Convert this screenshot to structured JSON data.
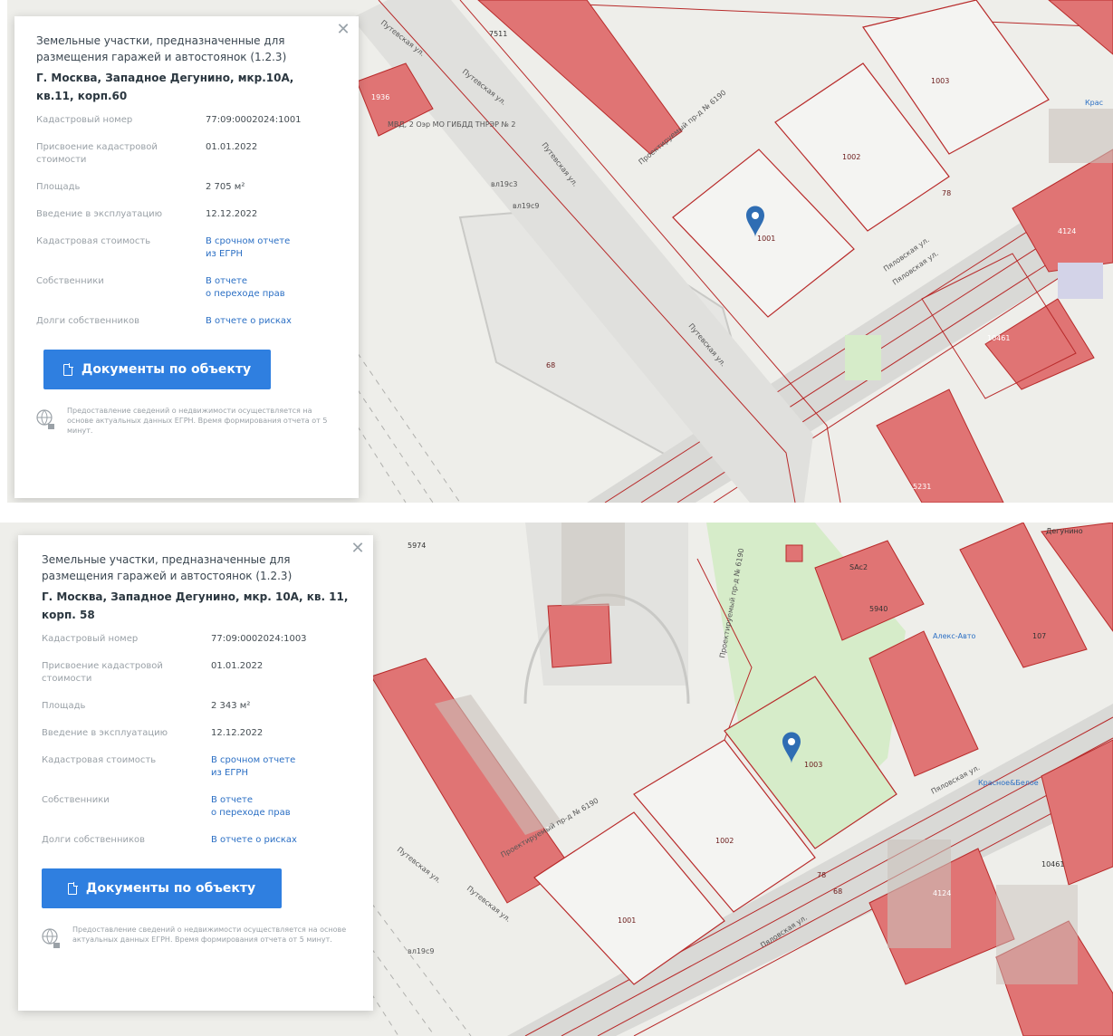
{
  "panels": [
    {
      "category": "Земельные участки, предназначенные для размещения гаражей и автостоянок (1.2.3)",
      "address": "Г. Москва, Западное Дегунино, мкр.10А, кв.11, корп.60",
      "rows": [
        {
          "label": "Кадастровый номер",
          "value": "77:09:0002024:1001"
        },
        {
          "label": "Присвоение кадастровой стоимости",
          "value": "01.01.2022"
        },
        {
          "label": "Площадь",
          "value": "2 705 м²"
        },
        {
          "label": "Введение в эксплуатацию",
          "value": "12.12.2022"
        },
        {
          "label": "Кадастровая стоимость",
          "value_line1": "В срочном отчете",
          "value_line2": "из ЕГРН"
        },
        {
          "label": "Собственники",
          "value_line1": "В отчете",
          "value_line2": "о переходе прав"
        },
        {
          "label": "Долги собственников",
          "value": "В отчете о рисках"
        }
      ],
      "button_label": "Документы по объекту",
      "note": "Предоставление сведений о недвижимости осуществляется на основе актуальных данных ЕГРН. Время формирования отчета от 5 минут.",
      "map": {
        "labels": {
          "p1001": "1001",
          "p1002": "1002",
          "p1003": "1003",
          "p68": "68",
          "p78": "78",
          "b7511": "7511",
          "b10461": "10461",
          "b4124": "4124",
          "b5231": "5231",
          "b1936": "1936",
          "st1": "Путевская ул.",
          "st2": "Путевская ул.",
          "st3": "Путевская ул.",
          "st4": "Путевская ул.",
          "st5": "Проектируемый пр-д № 6190",
          "st6": "Пяловская ул.",
          "st7": "Пяловская ул.",
          "poi": "МВД, 2 Оэр МО ГИБДД ТНРЭР № 2",
          "vl1": "вл19с3",
          "vl2": "вл19с9",
          "kr": "Крас"
        }
      }
    },
    {
      "category": "Земельные участки, предназначенные для размещения гаражей и автостоянок (1.2.3)",
      "address": "Г. Москва, Западное Дегунино, мкр. 10А, кв. 11, корп. 58",
      "rows": [
        {
          "label": "Кадастровый номер",
          "value": "77:09:0002024:1003"
        },
        {
          "label": "Присвоение кадастровой стоимости",
          "value": "01.01.2022"
        },
        {
          "label": "Площадь",
          "value": "2 343 м²"
        },
        {
          "label": "Введение в эксплуатацию",
          "value": "12.12.2022"
        },
        {
          "label": "Кадастровая стоимость",
          "value_line1": "В срочном отчете",
          "value_line2": "из ЕГРН"
        },
        {
          "label": "Собственники",
          "value_line1": "В отчете",
          "value_line2": "о переходе прав"
        },
        {
          "label": "Долги собственников",
          "value": "В отчете о рисках"
        }
      ],
      "button_label": "Документы по объекту",
      "note": "Предоставление сведений о недвижимости осуществляется на основе актуальных данных ЕГРН. Время формирования отчета от 5 минут.",
      "map": {
        "labels": {
          "p1001": "1001",
          "p1002": "1002",
          "p1003": "1003",
          "p68": "68",
          "p78": "78",
          "b5974": "5974",
          "b5940": "5940",
          "b10461": "10461",
          "b4124": "4124",
          "b107": "107",
          "st1": "Путевская ул.",
          "st2": "Путевская ул.",
          "st3": "Проектируемый пр-д № 6190",
          "st4": "Проектируемый пр-д № 6190",
          "st5": "Пяловская ул.",
          "st6": "Пяловская ул.",
          "poi1": "Алекс-Авто",
          "poi2": "Красное&Белое",
          "poi3": "Дегунино",
          "sac": "SAc2",
          "vl": "вл19с9"
        }
      }
    }
  ]
}
